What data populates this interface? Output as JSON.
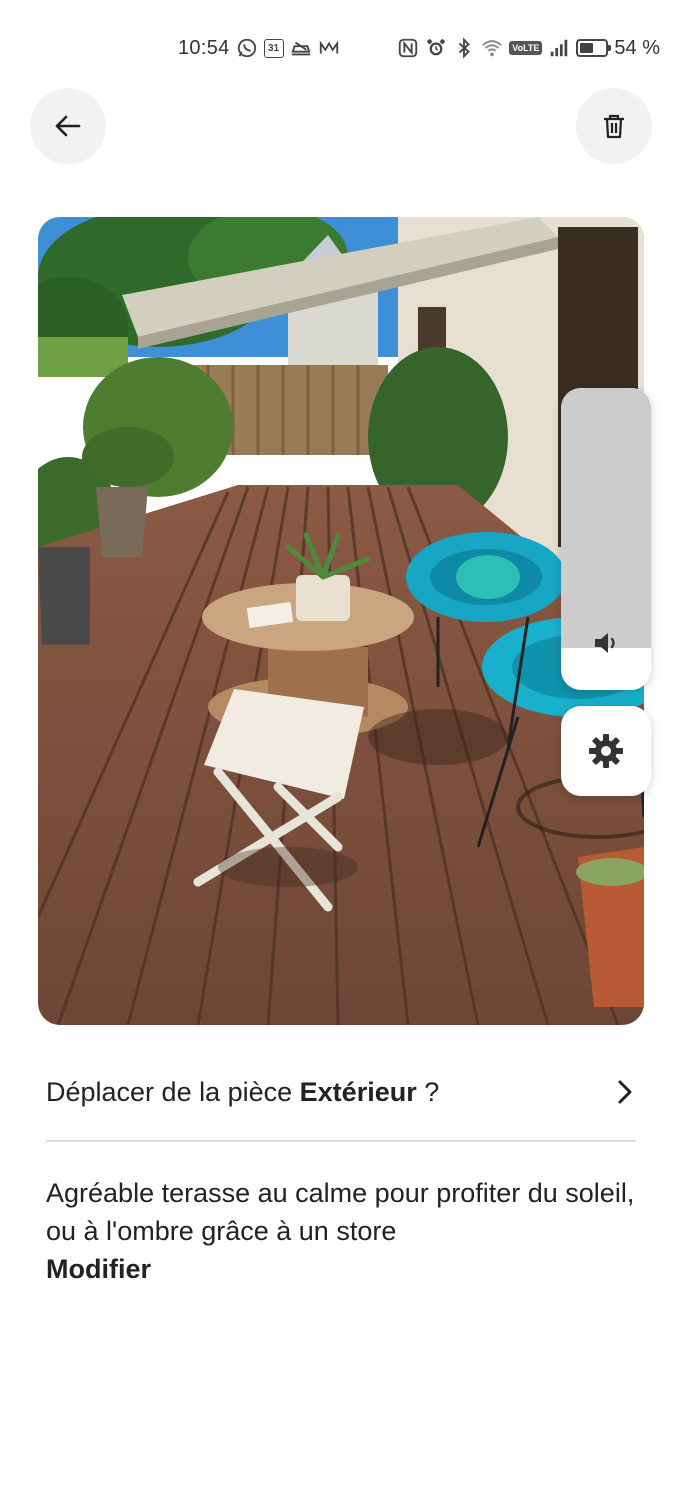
{
  "status_bar": {
    "time": "10:54",
    "calendar_day": "31",
    "network_type": "VoLTE",
    "battery_percent": "54 %",
    "battery_level": 0.54,
    "icons_left": [
      "whatsapp-icon",
      "calendar-icon",
      "car-icon",
      "mail-icon"
    ],
    "icons_right": [
      "nfc-icon",
      "alarm-icon",
      "bluetooth-icon",
      "wifi-icon",
      "volte-icon",
      "signal-icon",
      "battery-icon"
    ]
  },
  "header": {
    "back_icon": "arrow-left-icon",
    "delete_icon": "trash-icon"
  },
  "photo": {
    "subject": "terrace"
  },
  "volume_overlay": {
    "level": 0.86,
    "icon": "speaker-icon",
    "settings_icon": "gear-icon"
  },
  "move_row": {
    "prefix": "Déplacer de la pièce ",
    "room": "Extérieur",
    "suffix": " ?",
    "icon": "chevron-right-icon"
  },
  "description": {
    "text": "Agréable terasse au calme pour profiter du soleil, ou à l'ombre grâce à un store",
    "edit_label": "Modifier"
  }
}
